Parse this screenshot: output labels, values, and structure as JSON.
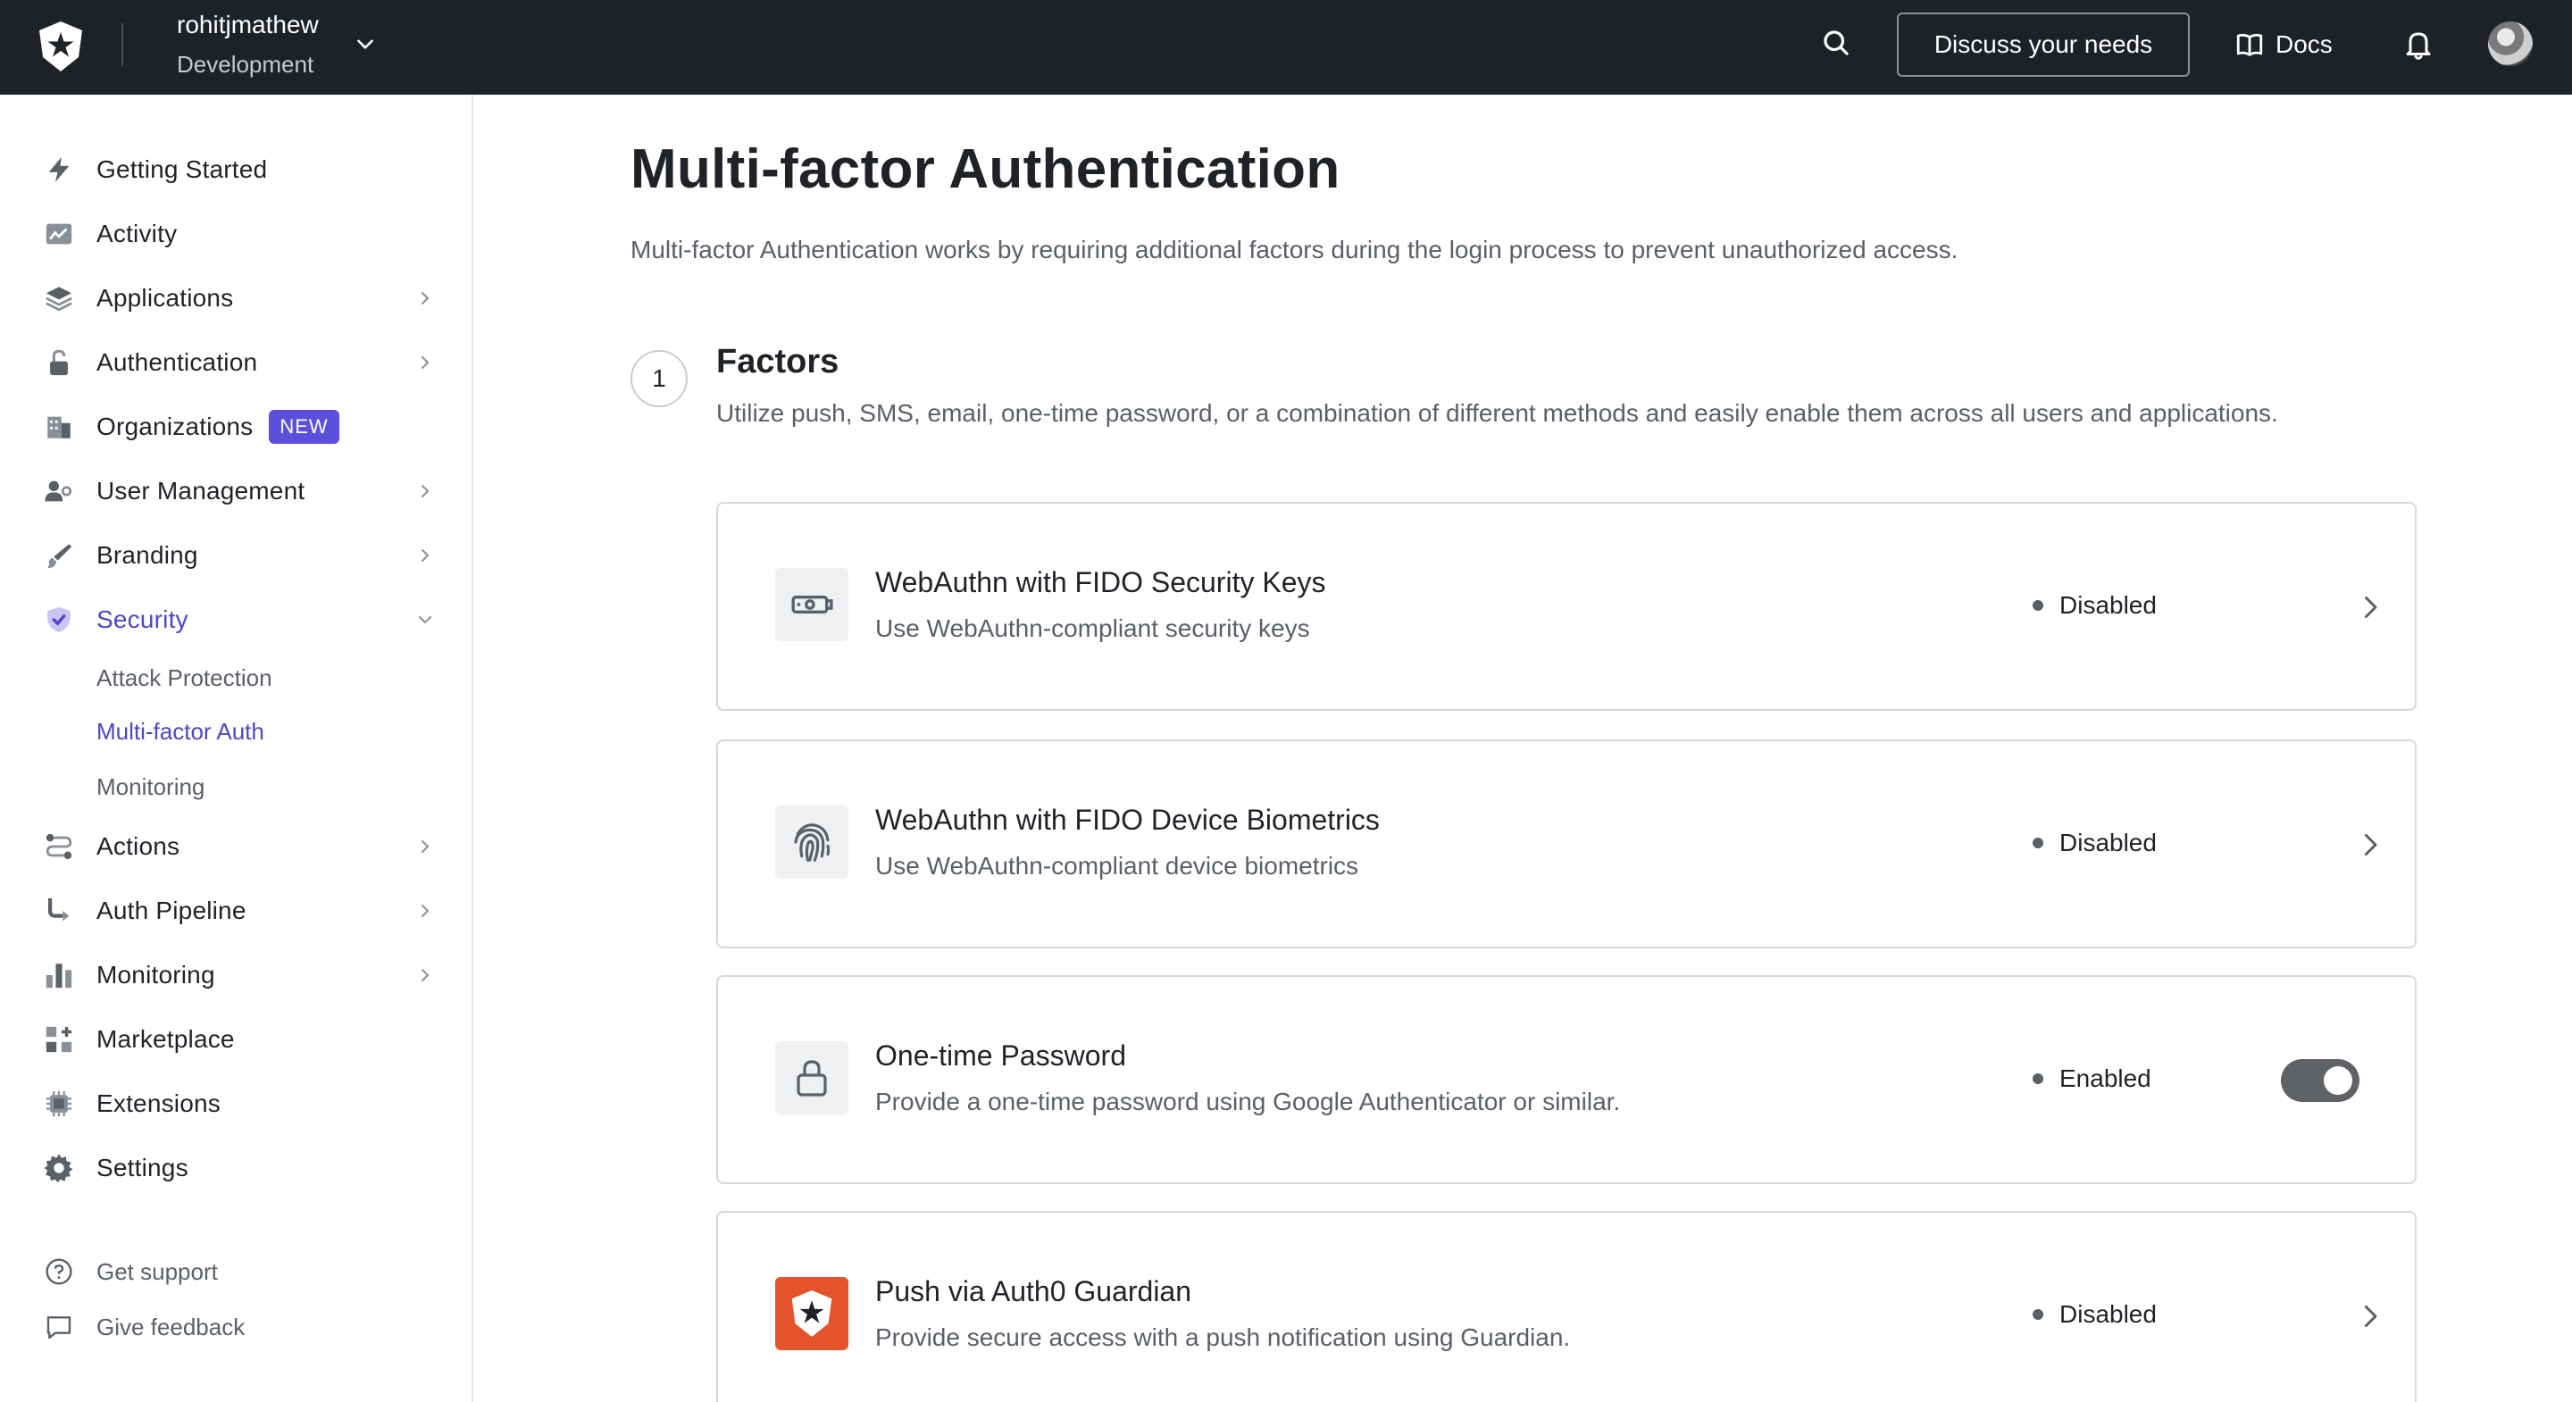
{
  "topbar": {
    "tenant_name": "rohitjmathew",
    "tenant_env": "Development",
    "discuss_label": "Discuss your needs",
    "docs_label": "Docs"
  },
  "sidebar": {
    "items": [
      {
        "label": "Getting Started",
        "icon": "lightning-icon"
      },
      {
        "label": "Activity",
        "icon": "activity-chart-icon"
      },
      {
        "label": "Applications",
        "icon": "layers-icon",
        "chevron": true
      },
      {
        "label": "Authentication",
        "icon": "padlock-open-icon",
        "chevron": true
      },
      {
        "label": "Organizations",
        "icon": "building-icon",
        "badge": "NEW"
      },
      {
        "label": "User Management",
        "icon": "users-gear-icon",
        "chevron": true
      },
      {
        "label": "Branding",
        "icon": "brush-icon",
        "chevron": true
      },
      {
        "label": "Security",
        "icon": "shield-check-icon",
        "expanded": true,
        "active": true
      },
      {
        "label": "Actions",
        "icon": "flow-icon",
        "chevron": true
      },
      {
        "label": "Auth Pipeline",
        "icon": "pipeline-icon",
        "chevron": true
      },
      {
        "label": "Monitoring",
        "icon": "bar-chart-icon",
        "chevron": true
      },
      {
        "label": "Marketplace",
        "icon": "grid-plus-icon"
      },
      {
        "label": "Extensions",
        "icon": "chip-icon"
      },
      {
        "label": "Settings",
        "icon": "gear-icon"
      }
    ],
    "security_subitems": [
      {
        "label": "Attack Protection"
      },
      {
        "label": "Multi-factor Auth",
        "active": true
      },
      {
        "label": "Monitoring"
      }
    ],
    "footer": [
      {
        "label": "Get support",
        "icon": "help-circle-icon"
      },
      {
        "label": "Give feedback",
        "icon": "chat-bubble-icon"
      }
    ]
  },
  "main": {
    "title": "Multi-factor Authentication",
    "description": "Multi-factor Authentication works by requiring additional factors during the login process to prevent unauthorized access.",
    "section": {
      "step": "1",
      "title": "Factors",
      "description": "Utilize push, SMS, email, one-time password, or a combination of different methods and easily enable them across all users and applications."
    },
    "factors": [
      {
        "title": "WebAuthn with FIDO Security Keys",
        "description": "Use WebAuthn-compliant security keys",
        "status": "Disabled",
        "icon": "security-key-icon"
      },
      {
        "title": "WebAuthn with FIDO Device Biometrics",
        "description": "Use WebAuthn-compliant device biometrics",
        "status": "Disabled",
        "icon": "fingerprint-icon"
      },
      {
        "title": "One-time Password",
        "description": "Provide a one-time password using Google Authenticator or similar.",
        "status": "Enabled",
        "icon": "lock-icon",
        "toggle_on": true
      },
      {
        "title": "Push via Auth0 Guardian",
        "description": "Provide secure access with a push notification using Guardian.",
        "status": "Disabled",
        "icon": "guardian-logo-icon"
      }
    ]
  },
  "colors": {
    "topbar_bg": "#1e2227",
    "accent": "#4f46c7",
    "badge_bg": "#5b4fdc",
    "guardian_bg": "#e5532d",
    "toggle_bg": "#5f6368"
  }
}
